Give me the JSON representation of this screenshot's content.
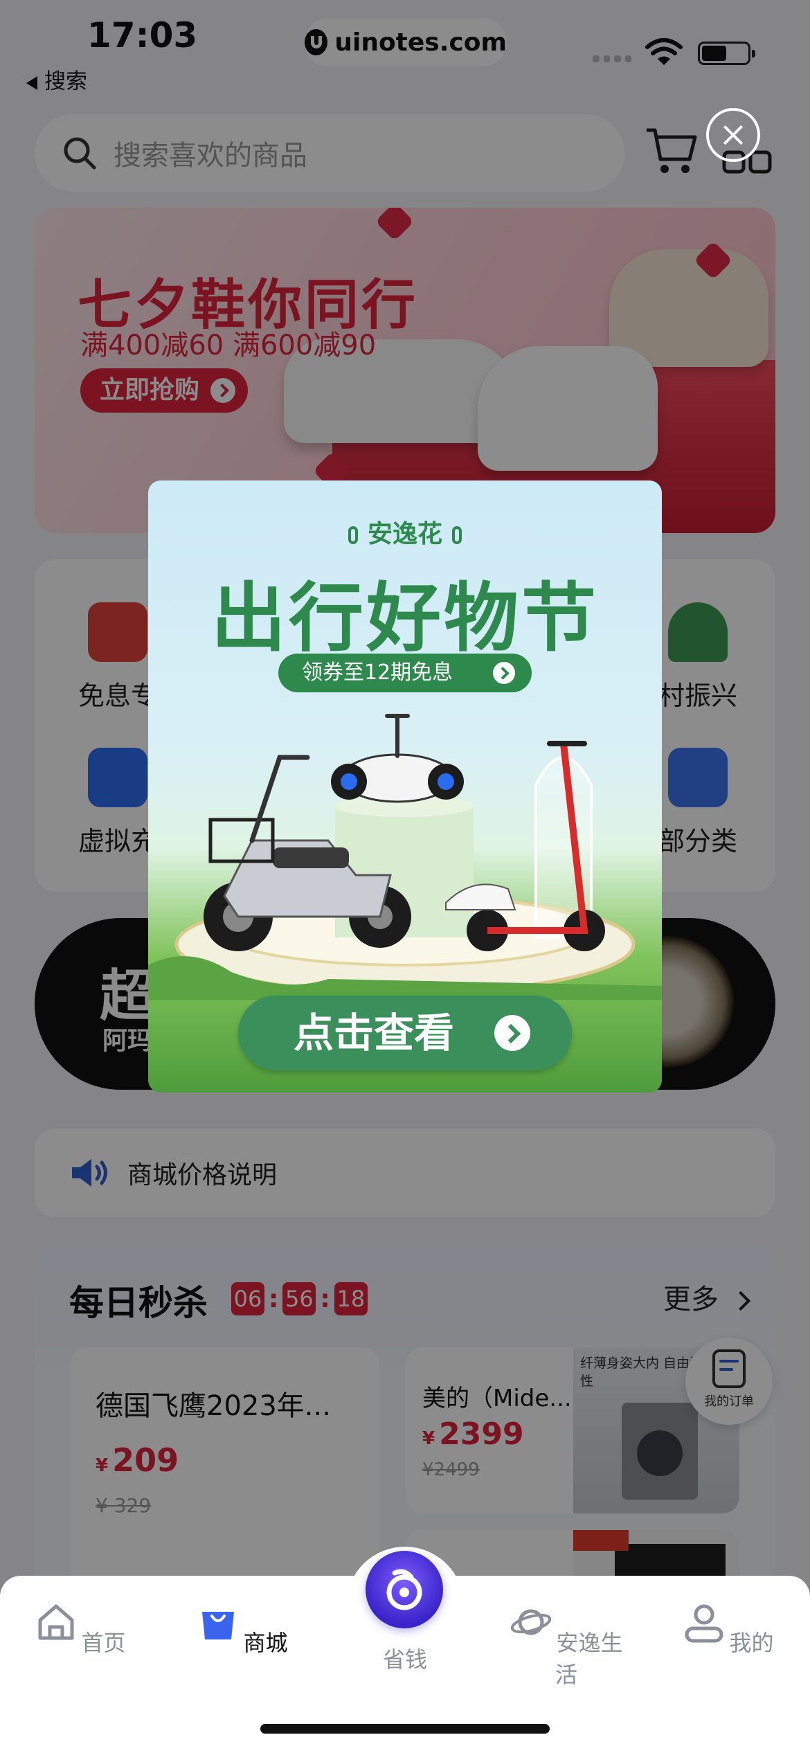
{
  "status_bar": {
    "time": "17:03",
    "back_label": "搜索",
    "watermark": "uinotes.com"
  },
  "search": {
    "placeholder": "搜索喜欢的商品"
  },
  "banner": {
    "title": "七夕鞋你同行",
    "subtitle": "满400减60 满600减90",
    "button_label": "立即抢购"
  },
  "categories": {
    "row1": [
      {
        "label": "免息专"
      },
      {
        "label": "村振兴"
      }
    ],
    "row2": [
      {
        "label": "虚拟充"
      },
      {
        "label": "部分类"
      }
    ]
  },
  "promo": {
    "big_text": "超",
    "small_text": "阿玛"
  },
  "notice": {
    "text": "商城价格说明"
  },
  "flash_sale": {
    "title": "每日秒杀",
    "timer": {
      "hours": "06",
      "minutes": "56",
      "seconds": "18"
    },
    "more_label": "更多",
    "products": [
      {
        "name": "德国飞鹰2023年...",
        "currency": "¥",
        "price": "209",
        "old_price": "¥ 329"
      },
      {
        "name": "美的（Mide...",
        "currency": "¥",
        "price": "2399",
        "old_price": "¥2499",
        "photo_caption": "纤薄身姿大内 自由洗护 个性"
      }
    ]
  },
  "order_float": {
    "label": "我的订单"
  },
  "popup": {
    "brand": "安逸花",
    "headline": "出行好物节",
    "pill_label": "领券至12期免息",
    "cta_label": "点击查看"
  },
  "tabbar": {
    "tabs": [
      {
        "label": "首页",
        "icon": "home-icon"
      },
      {
        "label": "商城",
        "icon": "shopping-bag-icon",
        "active": true
      },
      {
        "label": "省钱",
        "icon": "save-money-icon"
      },
      {
        "label": "安逸生活",
        "icon": "planet-icon"
      },
      {
        "label": "我的",
        "icon": "profile-icon"
      }
    ]
  },
  "colors": {
    "accent_red": "#e0233b",
    "popup_green": "#2e8a4c",
    "tab_active": "#3a64f0"
  }
}
